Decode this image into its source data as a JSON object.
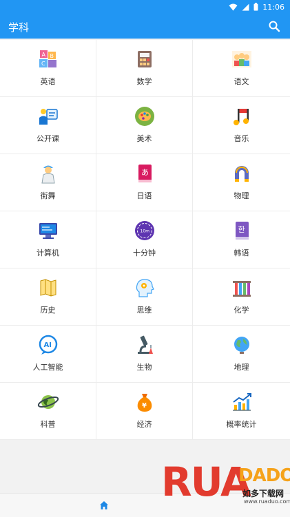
{
  "status": {
    "time": "11:06"
  },
  "app": {
    "title": "学科"
  },
  "subjects": [
    {
      "label": "英语",
      "icon": "abc-blocks-icon"
    },
    {
      "label": "数学",
      "icon": "calculator-book-icon"
    },
    {
      "label": "语文",
      "icon": "children-reading-icon"
    },
    {
      "label": "公开课",
      "icon": "teacher-board-icon"
    },
    {
      "label": "美术",
      "icon": "paint-palette-icon"
    },
    {
      "label": "音乐",
      "icon": "music-note-icon"
    },
    {
      "label": "街舞",
      "icon": "dancer-icon"
    },
    {
      "label": "日语",
      "icon": "japanese-book-icon"
    },
    {
      "label": "物理",
      "icon": "magnet-icon"
    },
    {
      "label": "计算机",
      "icon": "computer-icon"
    },
    {
      "label": "十分钟",
      "icon": "ten-minutes-clock-icon"
    },
    {
      "label": "韩语",
      "icon": "korean-book-icon"
    },
    {
      "label": "历史",
      "icon": "scroll-map-icon"
    },
    {
      "label": "思维",
      "icon": "brain-head-icon"
    },
    {
      "label": "化学",
      "icon": "test-tubes-icon"
    },
    {
      "label": "人工智能",
      "icon": "ai-badge-icon"
    },
    {
      "label": "生物",
      "icon": "microscope-icon"
    },
    {
      "label": "地理",
      "icon": "globe-icon"
    },
    {
      "label": "科普",
      "icon": "planet-icon"
    },
    {
      "label": "经济",
      "icon": "money-bag-icon"
    },
    {
      "label": "概率统计",
      "icon": "bar-chart-icon"
    }
  ],
  "watermark": {
    "letters": "RUA",
    "dado": "DADO",
    "subtitle": "如多下载网",
    "url": "www.ruaduo.com"
  },
  "colors": {
    "primary": "#2196f3"
  }
}
